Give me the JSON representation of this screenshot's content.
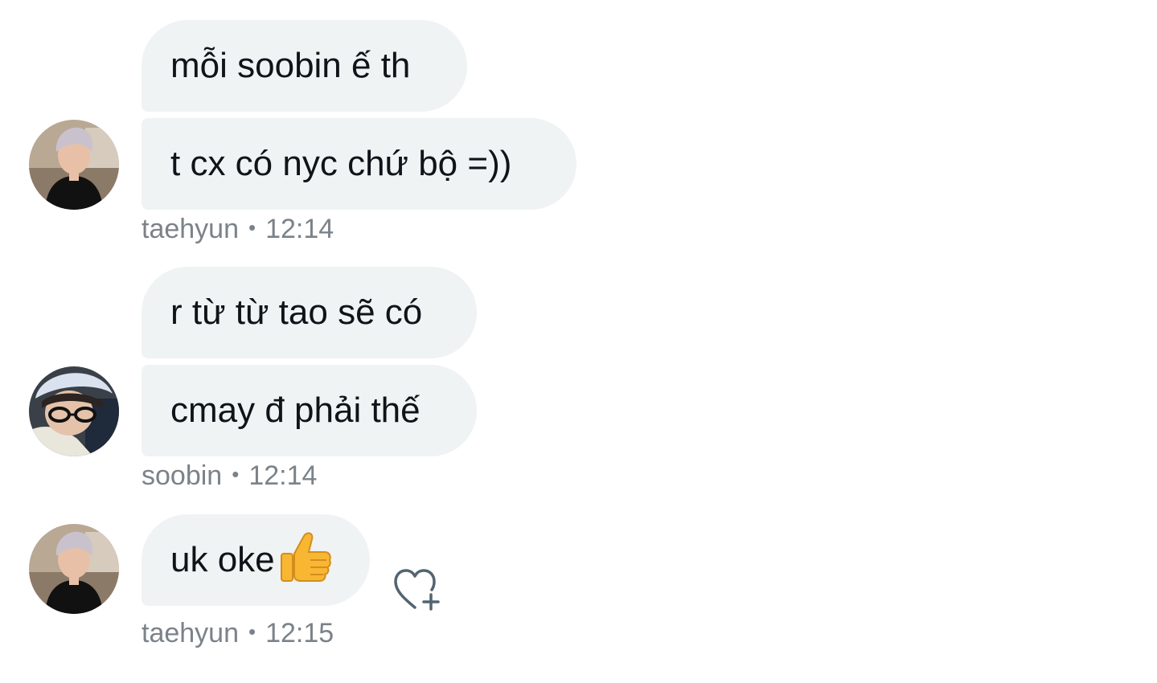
{
  "messages": [
    {
      "text": "mỗi soobin ế th",
      "sender": "taehyun"
    },
    {
      "text": "t cx có nyc chứ bộ =))",
      "sender": "taehyun"
    },
    {
      "text": "r từ từ tao sẽ có",
      "sender": "soobin"
    },
    {
      "text": "cmay đ phải thế",
      "sender": "soobin"
    },
    {
      "text": "uk oke",
      "emoji": "thumbs-up-emoji",
      "sender": "taehyun"
    }
  ],
  "groups": [
    {
      "sender": "taehyun",
      "time": "12:14",
      "avatar": "taehyun-avatar"
    },
    {
      "sender": "soobin",
      "time": "12:14",
      "avatar": "soobin-avatar"
    },
    {
      "sender": "taehyun",
      "time": "12:15",
      "avatar": "taehyun-avatar"
    }
  ],
  "separator": "•",
  "reaction_button": {
    "icon": "heart-plus-icon"
  },
  "colors": {
    "bubble_bg": "#eff3f4",
    "text": "#0f1419",
    "meta": "#7b8289",
    "icon": "#536471",
    "emoji": "#f7b733"
  }
}
